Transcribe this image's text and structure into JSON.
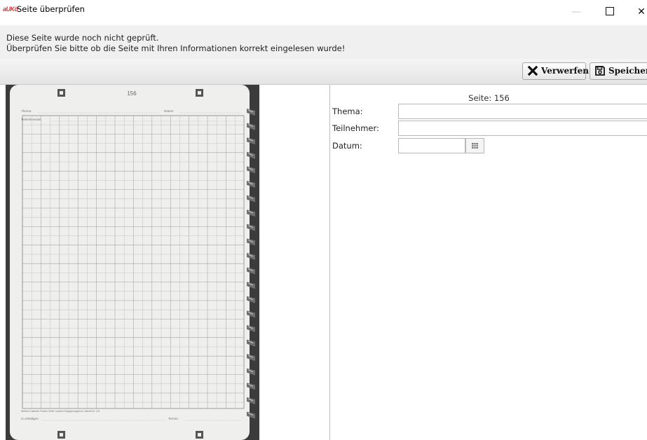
{
  "window": {
    "app_logo": "aUKö",
    "title": "Seite überprüfen",
    "minimize_glyph": "—",
    "close_glyph": "✕"
  },
  "info": {
    "line1": "Diese Seite wurde noch nicht geprüft.",
    "line2": "Überprüfen Sie bitte ob die Seite mit Ihren Informationen korrekt eingelesen wurde!"
  },
  "toolbar": {
    "discard_label": "Verwerfen",
    "discard_icon": "x-icon",
    "save_label": "Speichern",
    "save_icon": "floppy-disk-icon"
  },
  "scan": {
    "page_number": "156",
    "thema_label": "Thema:",
    "datum_label": "Datum:",
    "teilnehmende_label": "Teilnehmende:",
    "footer_note": "Weitere Kalender Fischer Seite* unseren Begegnungsbuch. Aktuell Nr. 151",
    "erledigen_label": "zu erledigen:",
    "termin_label": "Termin:"
  },
  "form": {
    "page_label": "Seite: 156",
    "thema_label": "Thema:",
    "thema_value": "",
    "teilnehmer_label": "Teilnehmer:",
    "teilnehmer_value": "",
    "datum_label": "Datum:",
    "datum_value": "",
    "calendar_icon": "calendar-icon"
  },
  "colors": {
    "toolbar_bg": "#ececec",
    "info_bg": "#f0f0f0",
    "scan_background": "#3a3a3a",
    "paper": "#f2f2f0",
    "grid": "#9a9a9a",
    "logo": "#d9302c"
  }
}
